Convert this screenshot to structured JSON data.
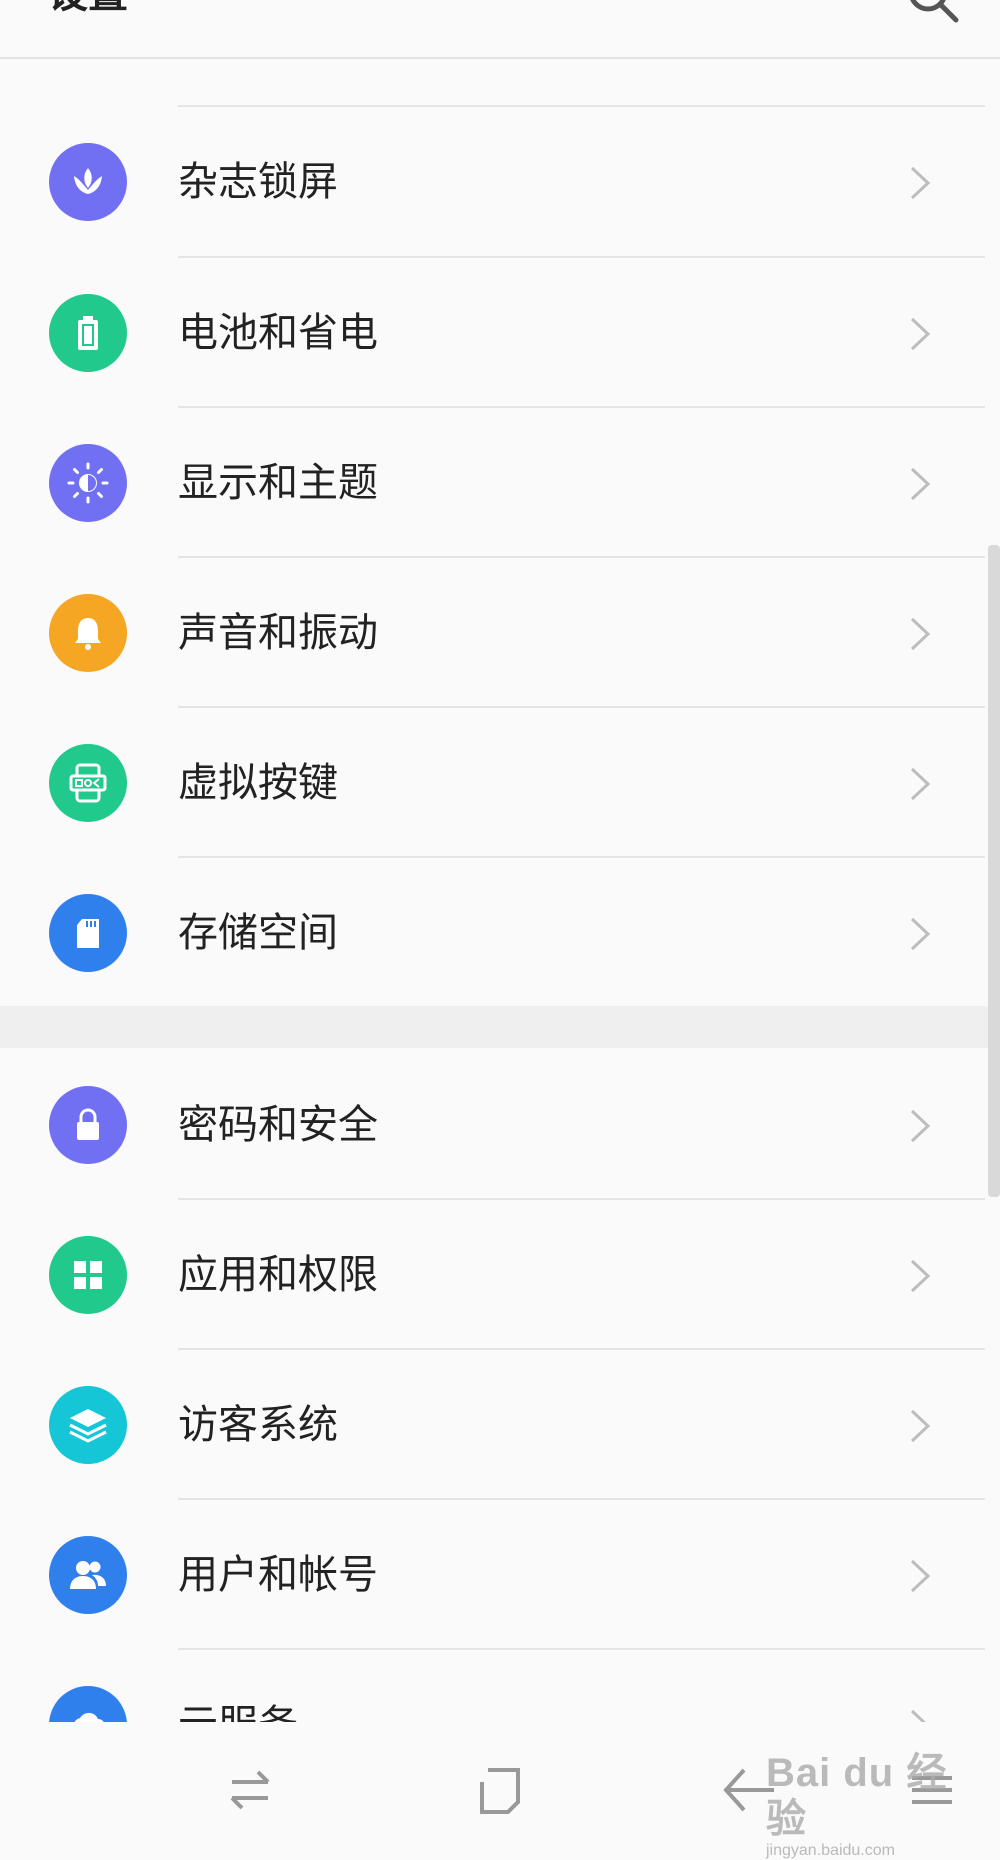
{
  "header": {
    "title": "设置"
  },
  "items": [
    {
      "label": "杂志锁屏",
      "icon": "lotus-icon",
      "color": "#7170f2"
    },
    {
      "label": "电池和省电",
      "icon": "battery-icon",
      "color": "#21c98c"
    },
    {
      "label": "显示和主题",
      "icon": "brightness-icon",
      "color": "#7170f2"
    },
    {
      "label": "声音和振动",
      "icon": "bell-icon",
      "color": "#f5a623"
    },
    {
      "label": "虚拟按键",
      "icon": "virtual-keys-icon",
      "color": "#21c98c"
    },
    {
      "label": "存储空间",
      "icon": "sd-card-icon",
      "color": "#2f80ed"
    },
    {
      "label": "密码和安全",
      "icon": "lock-icon",
      "color": "#7170f2"
    },
    {
      "label": "应用和权限",
      "icon": "apps-grid-icon",
      "color": "#21c98c"
    },
    {
      "label": "访客系统",
      "icon": "layers-icon",
      "color": "#15c7d6"
    },
    {
      "label": "用户和帐号",
      "icon": "users-icon",
      "color": "#2f80ed"
    },
    {
      "label": "云服务",
      "icon": "cloud-icon",
      "color": "#2f80ed"
    }
  ],
  "navbar": {
    "buttons": [
      "switch-apps-icon",
      "home-icon",
      "back-icon",
      "menu-icon"
    ]
  },
  "watermark": {
    "main": "Bai du 经验",
    "sub": "jingyan.baidu.com"
  }
}
